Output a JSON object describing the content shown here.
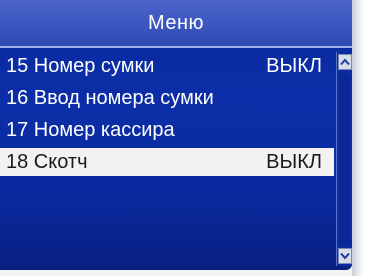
{
  "title": "Меню",
  "items": [
    {
      "label": "15 Номер сумки",
      "value": "ВЫКЛ",
      "selected": false
    },
    {
      "label": "16 Ввод номера сумки",
      "value": "",
      "selected": false
    },
    {
      "label": "17 Номер кассира",
      "value": "",
      "selected": false
    },
    {
      "label": "18 Скотч",
      "value": "ВЫКЛ",
      "selected": true
    }
  ],
  "scrollbar": {
    "up_icon": "chevron-up-icon",
    "down_icon": "chevron-down-icon"
  },
  "colors": {
    "screen_background": "#0b2ea8",
    "title_bar": "#3a55bf",
    "selected_row": "#f2f2f2",
    "text": "#ffffff"
  }
}
